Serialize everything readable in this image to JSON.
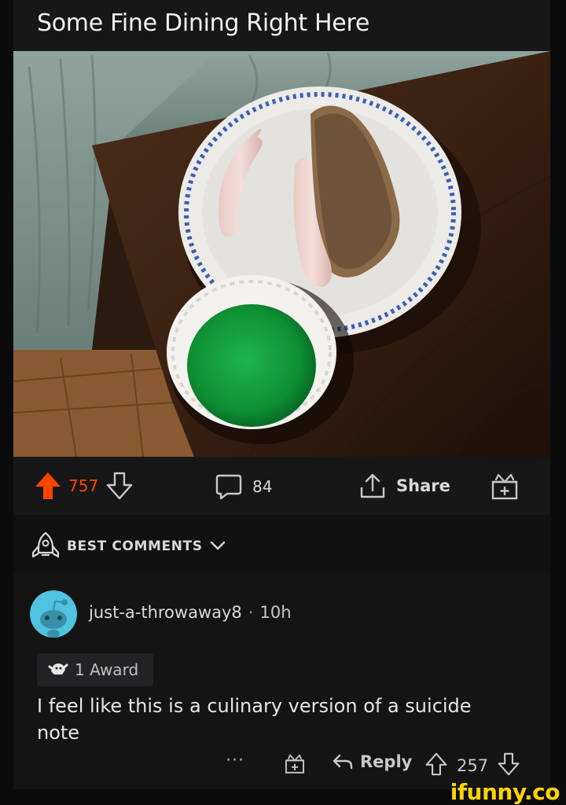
{
  "post": {
    "title": "Some Fine Dining Right Here",
    "image_icon": "photo-plate-sausages-bread-green-jelly",
    "upvote_icon": "upvote-arrow-icon",
    "votes": "757",
    "comments": "84",
    "share_label": "Share",
    "accent": "#ff4500"
  },
  "sort": {
    "label": "BEST COMMENTS"
  },
  "comment": {
    "username": "just-a-throwaway8",
    "separator": "·",
    "time": "10h",
    "award_text": "1 Award",
    "body": "I feel like this is a culinary version of a suicide note",
    "more": "···",
    "reply_label": "Reply",
    "votes": "257"
  },
  "watermark": "ifunny.co"
}
